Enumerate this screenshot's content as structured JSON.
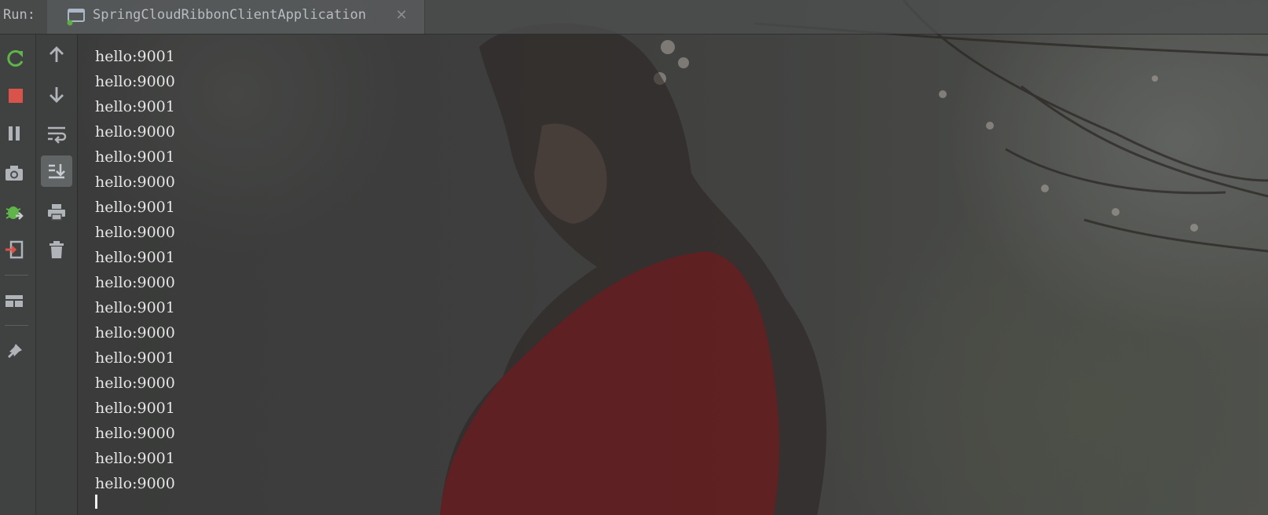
{
  "run_panel": {
    "label": "Run:",
    "tab": {
      "title": "SpringCloudRibbonClientApplication",
      "icon": "run-config-icon",
      "close_icon": "close-icon"
    }
  },
  "toolbar_primary": [
    {
      "name": "rerun-button",
      "icon": "rerun-icon"
    },
    {
      "name": "stop-button",
      "icon": "stop-icon"
    },
    {
      "name": "pause-button",
      "icon": "pause-icon"
    },
    {
      "name": "dump-threads-button",
      "icon": "camera-icon"
    },
    {
      "name": "debug-button",
      "icon": "debug-bug-icon"
    },
    {
      "name": "exit-button",
      "icon": "exit-icon"
    },
    {
      "name": "layout-button",
      "icon": "layout-icon"
    },
    {
      "name": "pin-button",
      "icon": "pin-icon"
    }
  ],
  "toolbar_secondary": [
    {
      "name": "scroll-up-button",
      "icon": "arrow-up-icon"
    },
    {
      "name": "scroll-down-button",
      "icon": "arrow-down-icon"
    },
    {
      "name": "soft-wrap-button",
      "icon": "soft-wrap-icon"
    },
    {
      "name": "scroll-to-end-button",
      "icon": "scroll-to-end-icon",
      "active": true
    },
    {
      "name": "print-button",
      "icon": "print-icon"
    },
    {
      "name": "clear-all-button",
      "icon": "trash-icon"
    }
  ],
  "console": {
    "lines": [
      "hello:9001",
      "hello:9000",
      "hello:9001",
      "hello:9000",
      "hello:9001",
      "hello:9000",
      "hello:9001",
      "hello:9000",
      "hello:9001",
      "hello:9000",
      "hello:9001",
      "hello:9000",
      "hello:9001",
      "hello:9000",
      "hello:9001",
      "hello:9000",
      "hello:9001",
      "hello:9000"
    ]
  },
  "colors": {
    "console_text": "#e6e6e6",
    "rerun_green": "#5fb44a",
    "stop_red": "#d9534a",
    "icon_gray": "#b0b4b8"
  }
}
